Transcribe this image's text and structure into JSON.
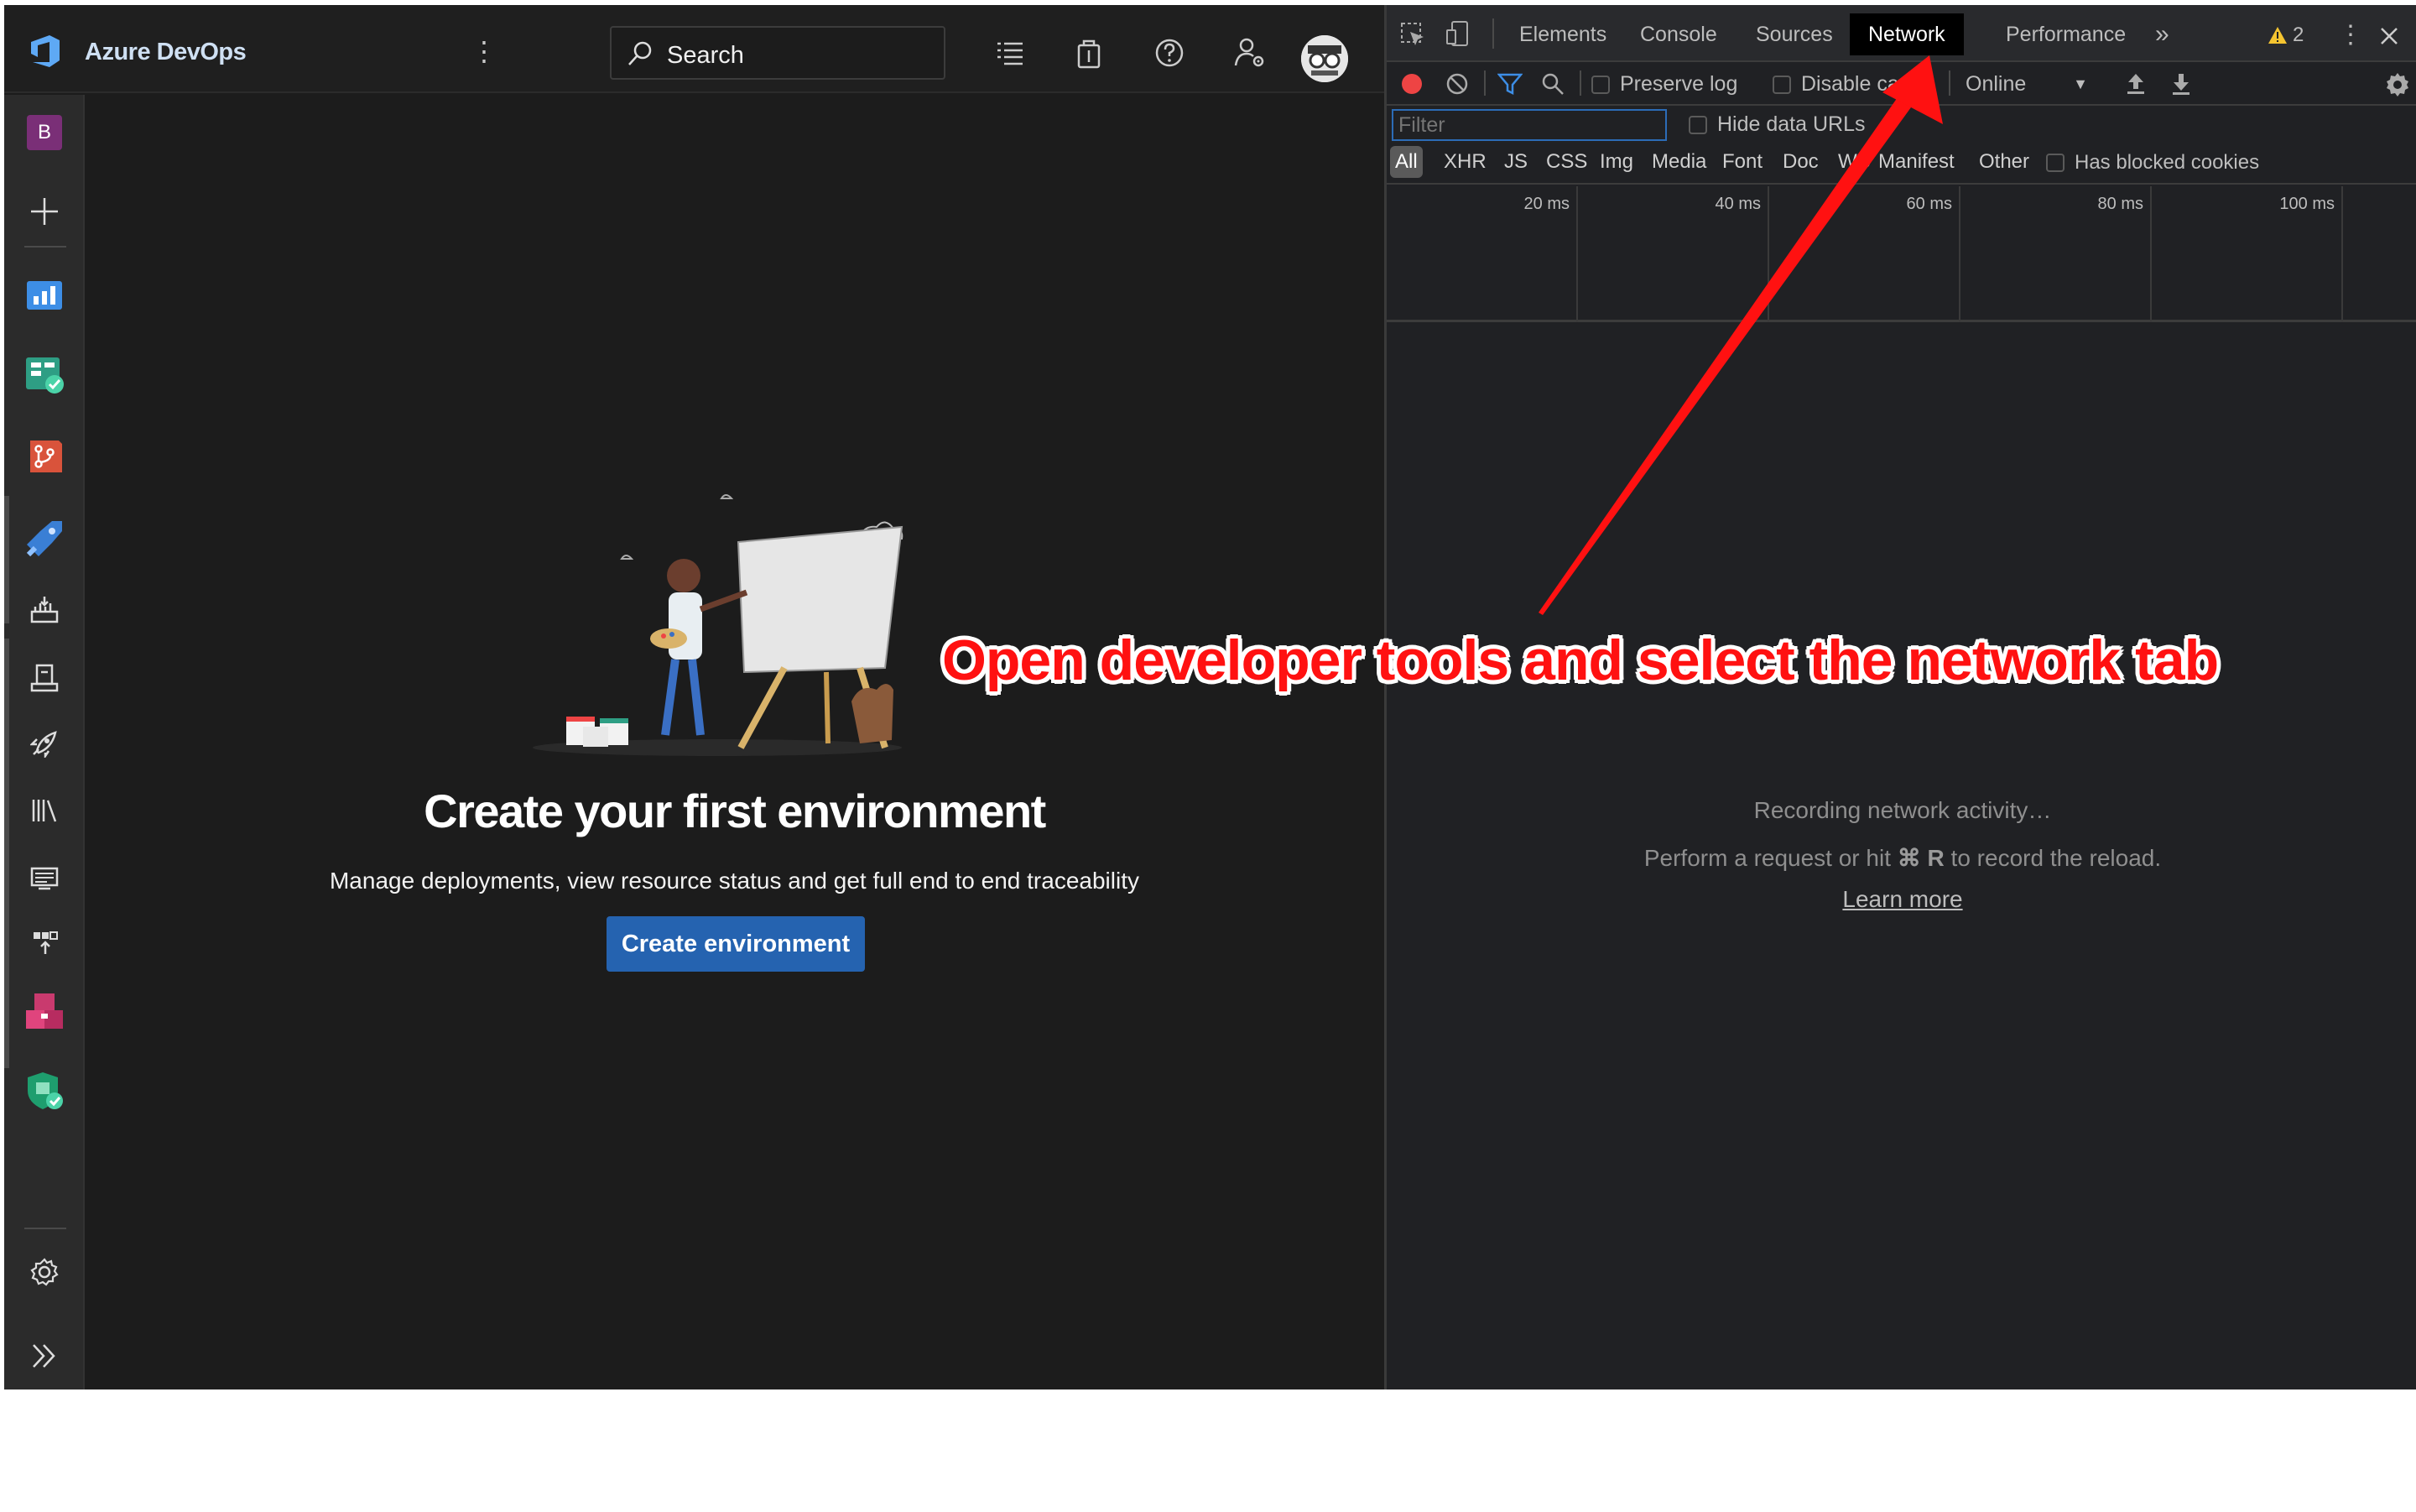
{
  "header": {
    "app_name": "Azure DevOps",
    "search_placeholder": "Search"
  },
  "sidebar": {
    "project_initial": "B",
    "items": [
      {
        "name": "new"
      },
      {
        "name": "overview"
      },
      {
        "name": "boards"
      },
      {
        "name": "repos"
      },
      {
        "name": "pipelines"
      },
      {
        "name": "artifacts-build"
      },
      {
        "name": "environments"
      },
      {
        "name": "releases"
      },
      {
        "name": "library"
      },
      {
        "name": "task-groups"
      },
      {
        "name": "deployment-groups"
      },
      {
        "name": "artifacts"
      },
      {
        "name": "security"
      }
    ]
  },
  "main": {
    "title": "Create your first environment",
    "subtitle": "Manage deployments, view resource status and get full end to end traceability",
    "button_label": "Create environment"
  },
  "devtools": {
    "tabs": [
      "Elements",
      "Console",
      "Sources",
      "Network",
      "Performance"
    ],
    "active_tab": "Network",
    "more_tabs": "»",
    "warning_count": "2",
    "toolbar": {
      "preserve_log": "Preserve log",
      "disable_cache": "Disable ca",
      "throttle": "Online"
    },
    "filter_placeholder": "Filter",
    "hide_data_urls": "Hide data URLs",
    "types": [
      "All",
      "XHR",
      "JS",
      "CSS",
      "Img",
      "Media",
      "Font",
      "Doc",
      "WS",
      "Manifest",
      "Other"
    ],
    "has_blocked_cookies": "Has blocked cookies",
    "timeline_ticks": [
      "20 ms",
      "40 ms",
      "60 ms",
      "80 ms",
      "100 ms"
    ],
    "empty_line1": "Recording network activity…",
    "empty_line2_prefix": "Perform a request or hit",
    "empty_shortcut": "⌘ R",
    "empty_line2_suffix": "to record the reload.",
    "learn_more": "Learn more"
  },
  "annotation": {
    "text": "Open developer tools and select the network tab",
    "color": "#ff1111"
  },
  "colors": {
    "accent_blue": "#2563b0",
    "devtools_bg": "#202124",
    "ado_bg": "#1c1c1c",
    "record_red": "#e44"
  }
}
